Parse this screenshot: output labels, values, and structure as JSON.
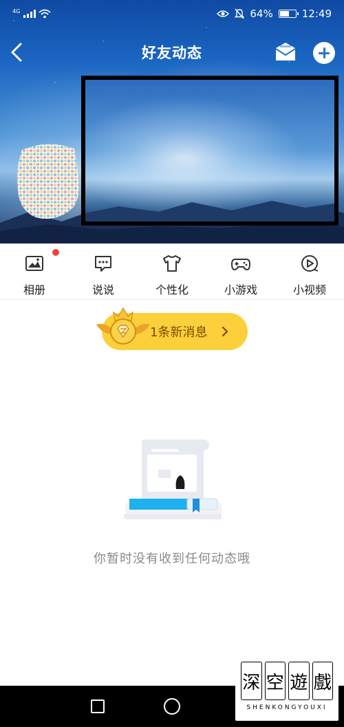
{
  "status_bar": {
    "network": "4G",
    "battery_percent": "64%",
    "battery_level": 0.64,
    "time": "12:49"
  },
  "header": {
    "title": "好友动态",
    "back_icon": "chevron-left-icon",
    "mail_icon": "mail-icon",
    "add_icon": "plus-circle-icon"
  },
  "menu": {
    "items": [
      {
        "label": "相册",
        "icon": "photo-album-icon",
        "has_dot": true
      },
      {
        "label": "说说",
        "icon": "speech-bubble-icon"
      },
      {
        "label": "个性化",
        "icon": "tshirt-icon"
      },
      {
        "label": "小游戏",
        "icon": "gamepad-icon"
      },
      {
        "label": "小视频",
        "icon": "play-circle-icon"
      }
    ]
  },
  "notification": {
    "label": "1条新消息",
    "chevron": "›"
  },
  "empty_state": {
    "message": "你暂时没有收到任何动态哦"
  },
  "watermark": {
    "chars": [
      "深",
      "空",
      "遊",
      "戲"
    ],
    "subtitle": "SHENKONGYOUXI"
  },
  "colors": {
    "accent_yellow": "#fcd03a",
    "notification_text": "#7a4a00",
    "dot_red": "#f2453d",
    "header_blue": "#1b66c2"
  }
}
